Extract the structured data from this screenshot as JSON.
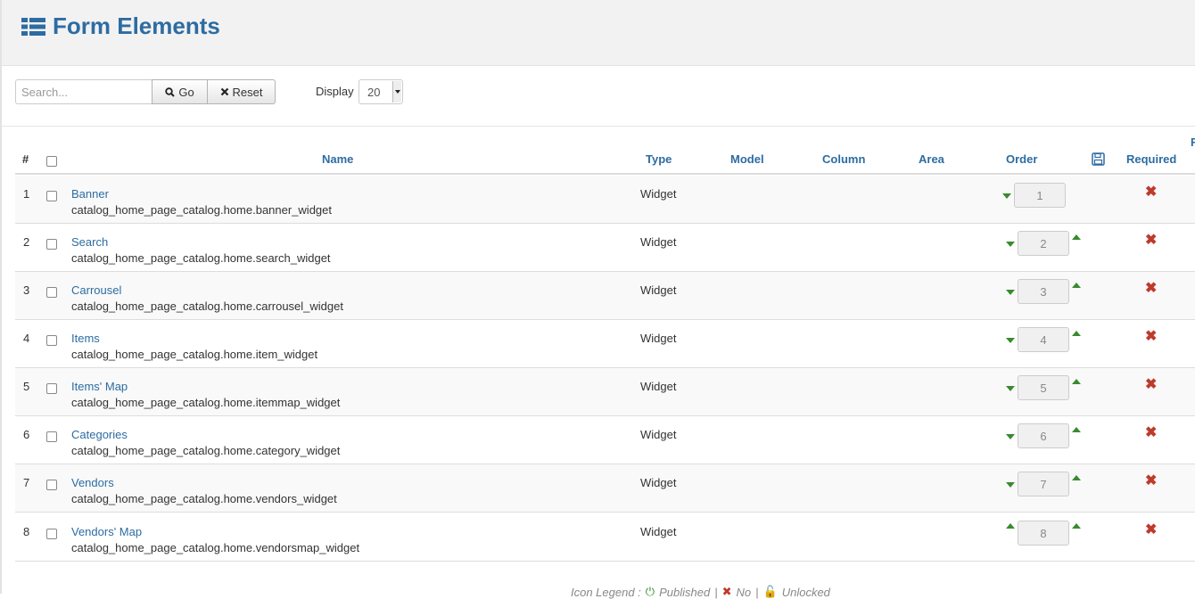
{
  "page": {
    "title": "Form Elements",
    "title_icon": "list-icon"
  },
  "toolbar": {
    "search_placeholder": "Search...",
    "go_label": "Go",
    "reset_label": "Reset",
    "display_label": "Display",
    "display_value": "20"
  },
  "table": {
    "columns": {
      "num": "#",
      "name": "Name",
      "type": "Type",
      "model": "Model",
      "column": "Column",
      "area": "Area",
      "order": "Order",
      "required": "Required"
    },
    "rows": [
      {
        "idx": "1",
        "name": "Banner",
        "sub": "catalog_home_page_catalog.home.banner_widget",
        "type": "Widget",
        "order": "1"
      },
      {
        "idx": "2",
        "name": "Search",
        "sub": "catalog_home_page_catalog.home.search_widget",
        "type": "Widget",
        "order": "2"
      },
      {
        "idx": "3",
        "name": "Carrousel",
        "sub": "catalog_home_page_catalog.home.carrousel_widget",
        "type": "Widget",
        "order": "3"
      },
      {
        "idx": "4",
        "name": "Items",
        "sub": "catalog_home_page_catalog.home.item_widget",
        "type": "Widget",
        "order": "4"
      },
      {
        "idx": "5",
        "name": "Items' Map",
        "sub": "catalog_home_page_catalog.home.itemmap_widget",
        "type": "Widget",
        "order": "5"
      },
      {
        "idx": "6",
        "name": "Categories",
        "sub": "catalog_home_page_catalog.home.category_widget",
        "type": "Widget",
        "order": "6"
      },
      {
        "idx": "7",
        "name": "Vendors",
        "sub": "catalog_home_page_catalog.home.vendors_widget",
        "type": "Widget",
        "order": "7"
      },
      {
        "idx": "8",
        "name": "Vendors' Map",
        "sub": "catalog_home_page_catalog.home.vendorsmap_widget",
        "type": "Widget",
        "order": "8"
      }
    ]
  },
  "legend": {
    "prefix": "Icon Legend :",
    "published": "Published",
    "no": "No",
    "unlocked": "Unlocked"
  },
  "colors": {
    "accent": "#2d6ca2",
    "required_no": "#c0392b",
    "order_arrow": "#3a8a2f"
  }
}
